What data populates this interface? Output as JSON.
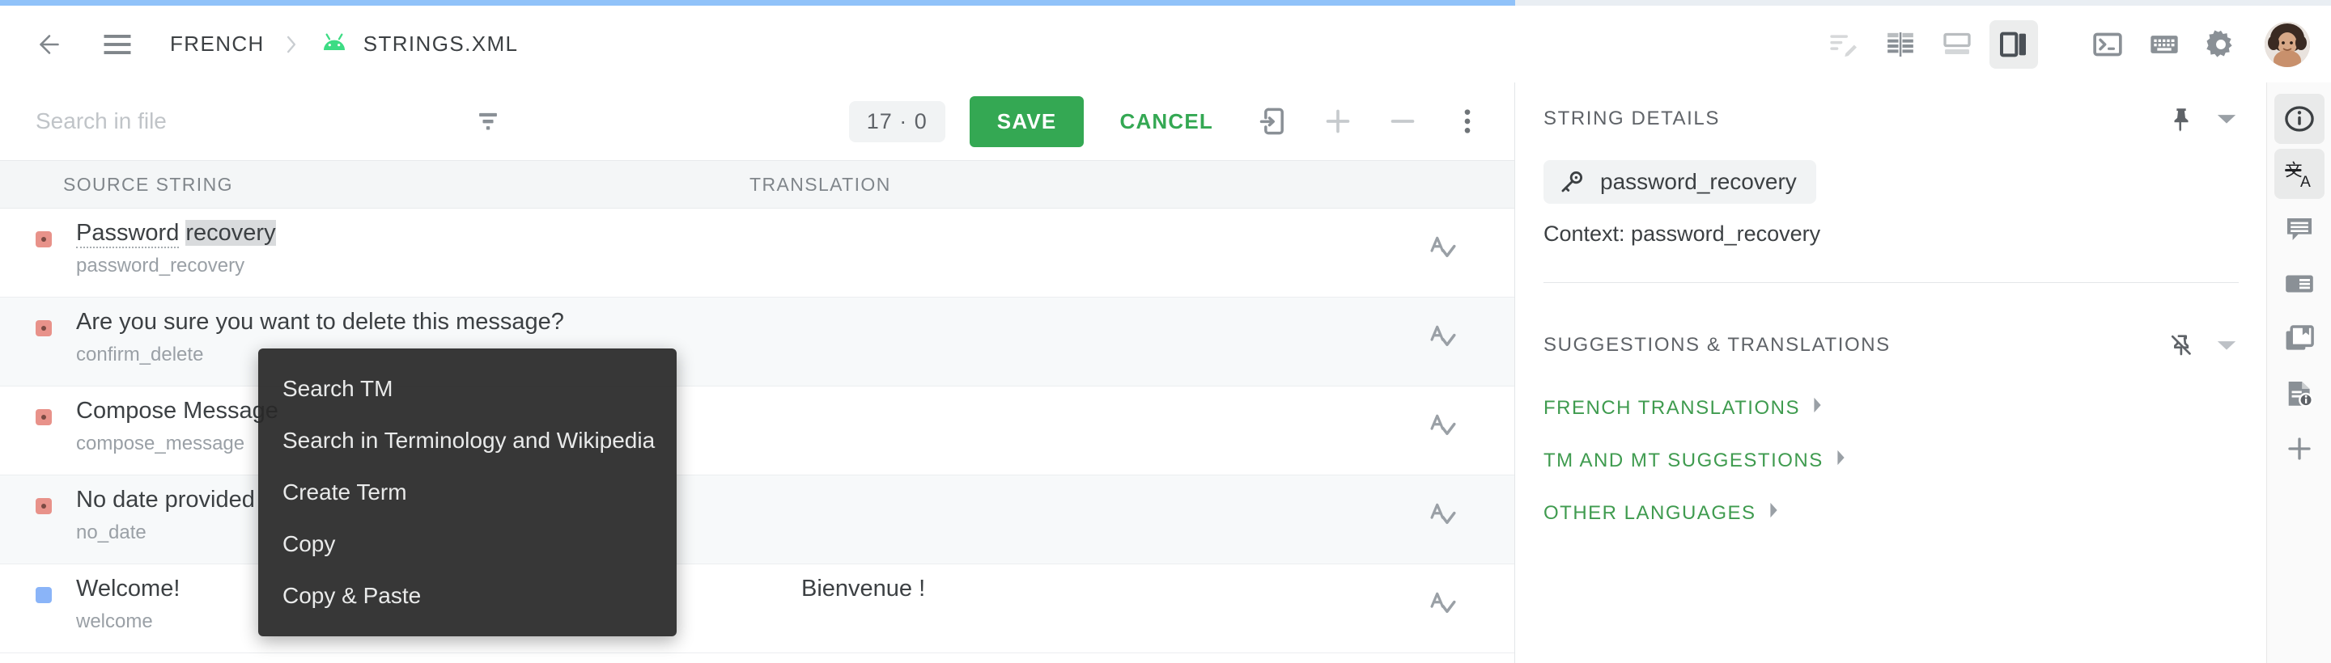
{
  "progress": {
    "percent": 65
  },
  "appbar": {
    "back_label": "back-arrow",
    "menu_label": "menu",
    "breadcrumb": {
      "language": "FRENCH",
      "file": "STRINGS.XML"
    },
    "tools": [
      {
        "name": "edit-note-icon",
        "label": "Edit note",
        "active": false
      },
      {
        "name": "split-columns-icon",
        "label": "Columns layout",
        "active": false
      },
      {
        "name": "horizontal-split-icon",
        "label": "Horizontal split",
        "active": false
      },
      {
        "name": "vertical-split-icon",
        "label": "Vertical split",
        "active": true
      },
      {
        "name": "terminal-icon",
        "label": "Terminal",
        "active": false
      },
      {
        "name": "keyboard-icon",
        "label": "Keyboard",
        "active": false
      },
      {
        "name": "gear-icon",
        "label": "Settings",
        "active": false
      }
    ],
    "avatar_label": "User account"
  },
  "editor_toolbar": {
    "search_placeholder": "Search in file",
    "search_value": "",
    "filter_label": "Filter",
    "counter": "17 · 0",
    "save_label": "SAVE",
    "cancel_label": "CANCEL",
    "copy_all_label": "Copy source to target",
    "add_label": "Add",
    "remove_label": "Remove",
    "more_label": "More options"
  },
  "table": {
    "columns": {
      "source": "SOURCE STRING",
      "translation": "TRANSLATION"
    },
    "rows": [
      {
        "status": "untranslated",
        "status_color": "#e8928a",
        "source_prefix": "Password ",
        "source_highlight": "recovery",
        "key": "password_recovery",
        "translation": "",
        "selected": true
      },
      {
        "status": "untranslated",
        "status_color": "#e8928a",
        "source_prefix": "Are you sure you want to delete this message?",
        "source_highlight": "",
        "key": "confirm_delete",
        "translation": "",
        "selected": false
      },
      {
        "status": "untranslated",
        "status_color": "#e8928a",
        "source_prefix": "Compose Message",
        "source_highlight": "",
        "key": "compose_message",
        "translation": "",
        "selected": false
      },
      {
        "status": "untranslated",
        "status_color": "#e8928a",
        "source_prefix": "No date provided",
        "source_highlight": "",
        "key": "no_date",
        "translation": "",
        "selected": false
      },
      {
        "status": "translated",
        "status_color": "#8ab4f8",
        "source_prefix": "Welcome!",
        "source_highlight": "",
        "key": "welcome",
        "translation": "Bienvenue !",
        "selected": false
      }
    ],
    "row_action_label": "Spell check"
  },
  "context_menu": {
    "items": [
      {
        "label": "Search TM"
      },
      {
        "label": "Search in Terminology and Wikipedia"
      },
      {
        "label": "Create Term"
      },
      {
        "label": "Copy"
      },
      {
        "label": "Copy & Paste"
      }
    ]
  },
  "details": {
    "string_details": {
      "title": "STRING DETAILS",
      "pin_label": "Pin panel",
      "collapse_label": "Collapse",
      "key_chip": "password_recovery",
      "context_line": "Context: password_recovery"
    },
    "suggestions": {
      "title": "SUGGESTIONS & TRANSLATIONS",
      "unpin_label": "Unpin panel",
      "collapse_label": "Collapse",
      "links": [
        {
          "label": "FRENCH TRANSLATIONS"
        },
        {
          "label": "TM AND MT SUGGESTIONS"
        },
        {
          "label": "OTHER LANGUAGES"
        }
      ]
    }
  },
  "rail": {
    "items": [
      {
        "name": "info-icon",
        "label": "String details",
        "active": true
      },
      {
        "name": "translate-icon",
        "label": "Translations",
        "active": true
      },
      {
        "name": "comment-icon",
        "label": "Comments",
        "active": false
      },
      {
        "name": "article-icon",
        "label": "Reference",
        "active": false
      },
      {
        "name": "library-icon",
        "label": "Glossary",
        "active": false
      },
      {
        "name": "document-info-icon",
        "label": "File info",
        "active": false
      },
      {
        "name": "plus-icon",
        "label": "Add panel",
        "active": false
      }
    ]
  },
  "colors": {
    "accent_green": "#34a853",
    "progress_blue": "#90c2f9",
    "status_red": "#e8928a",
    "status_blue": "#8ab4f8",
    "android_green": "#3ddc84"
  }
}
